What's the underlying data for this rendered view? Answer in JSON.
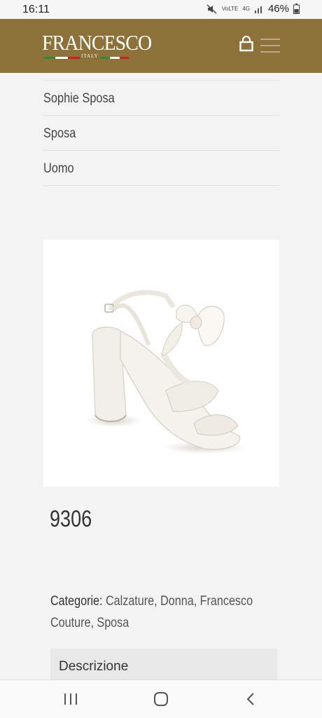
{
  "status_bar": {
    "time": "16:11",
    "network_line1": "VoLTE",
    "network_type": "4G",
    "battery_percent": "46%"
  },
  "header": {
    "logo_text": "FRANCESCO",
    "logo_sub": "ITALY",
    "bg_color": "#8c7138"
  },
  "categories_menu": {
    "items": [
      {
        "label": "Sophie Sposa"
      },
      {
        "label": "Sposa"
      },
      {
        "label": "Uomo"
      }
    ]
  },
  "product": {
    "title": "9306",
    "categories_key": "Categorie:",
    "categories_value": "Calzature, Donna, Francesco Couture, Sposa",
    "tab_label": "Descrizione"
  }
}
